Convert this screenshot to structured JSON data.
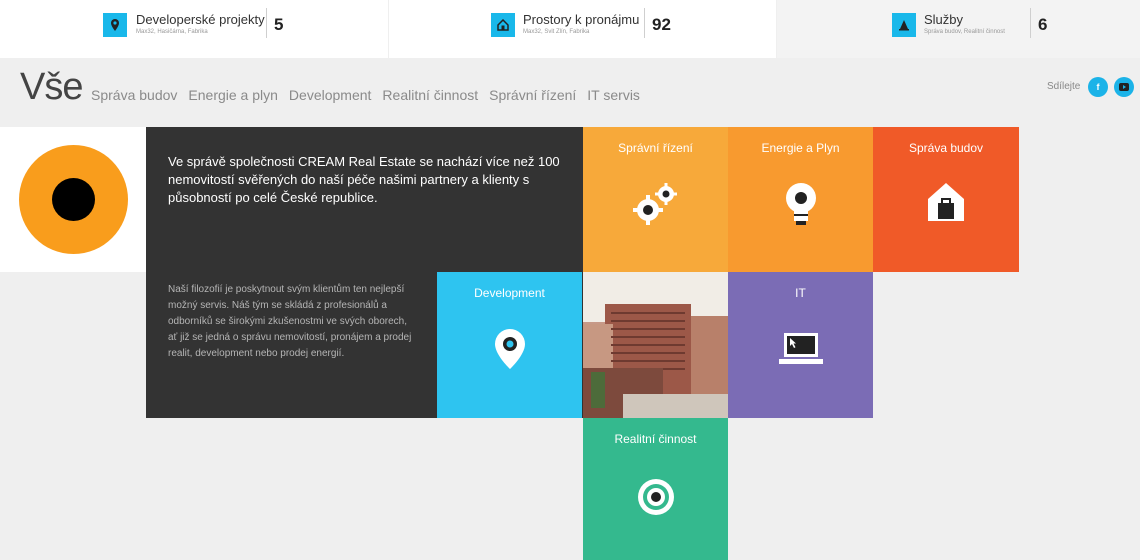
{
  "stats": [
    {
      "title": "Developerské projekty",
      "subtitle": "Max32, Hasičárna, Fabrika",
      "count": "5",
      "icon": "map-pin-icon"
    },
    {
      "title": "Prostory k pronájmu",
      "subtitle": "Max32, Svit Zlín, Fabrika",
      "count": "92",
      "icon": "building-icon"
    },
    {
      "title": "Služby",
      "subtitle": "Správa budov, Realitní činnost",
      "count": "6",
      "icon": "cone-icon"
    }
  ],
  "nav": {
    "logo": "Vše",
    "items": [
      "Správa budov",
      "Energie a plyn",
      "Development",
      "Realitní činnost",
      "Správní řízení",
      "IT servis"
    ],
    "share_label": "Sdílejte"
  },
  "intro": {
    "text": "Ve správě společnosti CREAM Real Estate se nachází více než 100 nemovitostí svěřených do naší péče našimi partnery a klienty s působností po celé České republice.",
    "philosophy": "Naší filozofií je poskytnout svým klientům ten nejlepší možný servis. Náš tým se skládá z profesionálů a odborníků se širokými zkušenostmi ve svých oborech, ať již se jedná o správu nemovitostí, pronájem a prodej realit, development nebo prodej energií."
  },
  "tiles": {
    "spravni": {
      "label": "Správní řízení",
      "color": "#f7a93a",
      "icon": "gears-icon"
    },
    "energie": {
      "label": "Energie a Plyn",
      "color": "#f89a2f",
      "icon": "lightbulb-icon"
    },
    "sprava": {
      "label": "Správa budov",
      "color": "#f05a28",
      "icon": "house-icon"
    },
    "development": {
      "label": "Development",
      "color": "#2ec4f0",
      "icon": "map-pin-icon"
    },
    "it": {
      "label": "IT",
      "color": "#7b6cb5",
      "icon": "laptop-icon"
    },
    "realitni": {
      "label": "Realitní činnost",
      "color": "#34b98e",
      "icon": "target-icon"
    }
  },
  "colors": {
    "accent": "#19b8ea",
    "dark_panel": "#333333",
    "logo_ring": "#f99d1c"
  }
}
